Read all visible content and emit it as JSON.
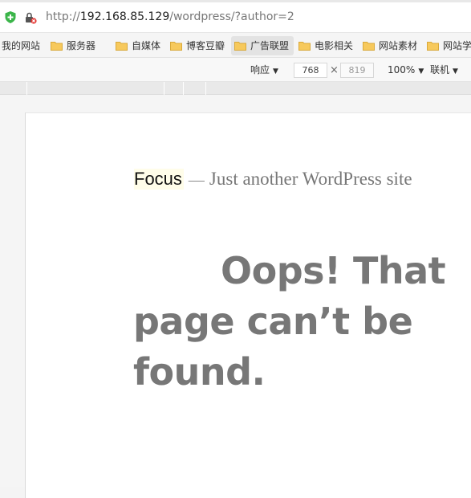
{
  "browser": {
    "url_prefix": "http://",
    "url_host": "192.168.85.129",
    "url_path": "/wordpress/?author=2"
  },
  "bookmarks": [
    {
      "label": "我的网站",
      "has_folder": false
    },
    {
      "label": "服务器",
      "has_folder": true
    },
    {
      "label": "自媒体",
      "has_folder": true
    },
    {
      "label": "博客豆瓣",
      "has_folder": true
    },
    {
      "label": "广告联盟",
      "has_folder": true,
      "active": true
    },
    {
      "label": "电影相关",
      "has_folder": true
    },
    {
      "label": "网站素材",
      "has_folder": true
    },
    {
      "label": "网站学",
      "has_folder": true
    }
  ],
  "device_toolbar": {
    "mode_label": "响应",
    "width": "768",
    "height": "819",
    "zoom": "100%",
    "network": "联机",
    "times": "×"
  },
  "page": {
    "site_title": "Focus",
    "separator": "—",
    "site_description": "Just another WordPress site",
    "heading": "Oops! That page can’t be found."
  },
  "colors": {
    "heading": "#777777",
    "folder": "#f7c95c",
    "shield": "#3bb54a"
  }
}
